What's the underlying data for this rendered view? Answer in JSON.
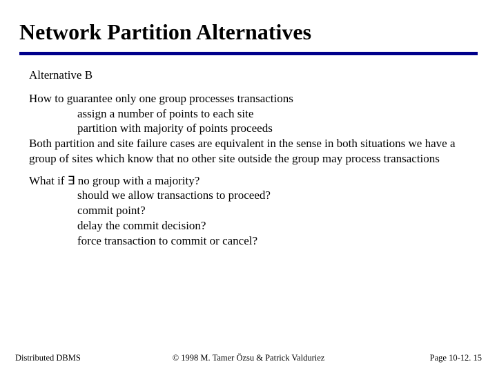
{
  "title": "Network Partition Alternatives",
  "subhead": "Alternative B",
  "p1": {
    "lead": "How to guarantee only one group processes transactions",
    "b1": "assign a number of points to each site",
    "b2": "partition with majority of points proceeds",
    "tail": "Both partition and site failure cases are equivalent in the sense in both situations we have a group of sites which know that no other site outside the group may process transactions"
  },
  "p2": {
    "lead": "What if ∃ no group with a majority?",
    "b1": "should we allow transactions to proceed?",
    "b2": "commit point?",
    "b3": "delay the commit decision?",
    "b4": "force transaction to commit or cancel?"
  },
  "footer": {
    "left": "Distributed DBMS",
    "center": "© 1998 M. Tamer Özsu & Patrick Valduriez",
    "right": "Page 10-12. 15"
  }
}
